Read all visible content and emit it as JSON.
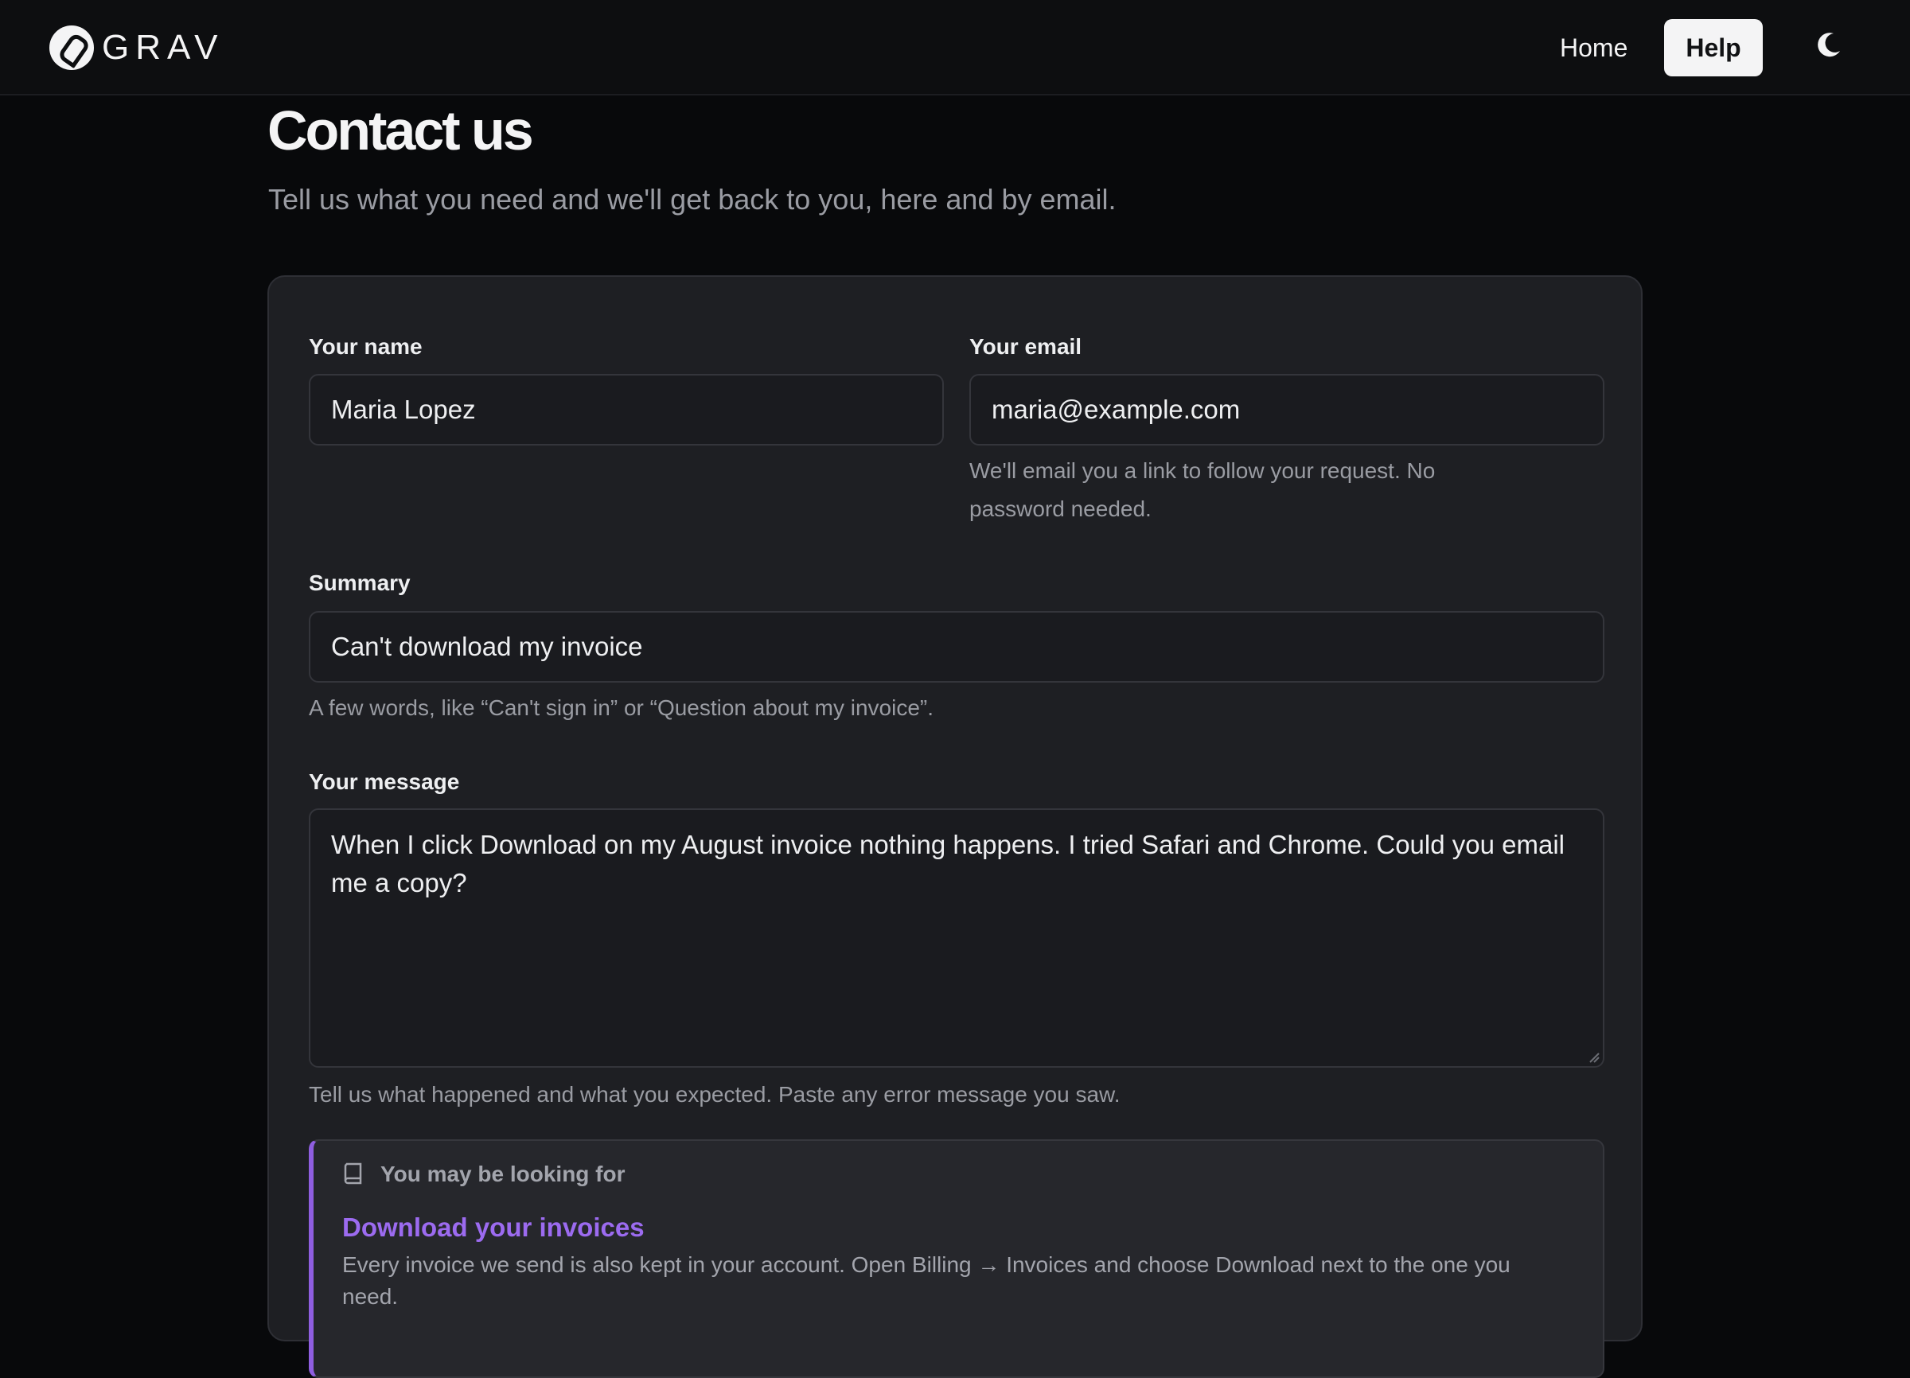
{
  "header": {
    "logo_text": "GRAV",
    "nav": {
      "home_label": "Home",
      "help_label": "Help"
    },
    "theme_icon": "moon-icon"
  },
  "page": {
    "title": "Contact us",
    "subtitle": "Tell us what you need and we'll get back to you, here and by email."
  },
  "form": {
    "name": {
      "label": "Your name",
      "value": "Maria Lopez"
    },
    "email": {
      "label": "Your email",
      "value": "maria@example.com",
      "help_line1": "We'll email you a link to follow your request. No",
      "help_line2": "password needed."
    },
    "summary": {
      "label": "Summary",
      "value": "Can't download my invoice",
      "help": "A few words, like “Can't sign in” or “Question about my invoice”."
    },
    "message": {
      "label": "Your message",
      "value": "When I click Download on my August invoice nothing happens. I tried Safari and Chrome. Could you email me a copy?",
      "help": "Tell us what happened and what you expected. Paste any error message you saw."
    }
  },
  "suggestion": {
    "heading": "You may be looking for",
    "icon": "book-icon",
    "link_title": "Download your invoices",
    "text": "Every invoice we send is also kept in your account. Open Billing → Invoices and choose Download next to the one you need."
  },
  "colors": {
    "background": "#08090b",
    "card": "#1e1f23",
    "accent": "#9c6bf0",
    "accent_border": "#8f5ee0",
    "help_button_bg": "#f4f4f5"
  }
}
